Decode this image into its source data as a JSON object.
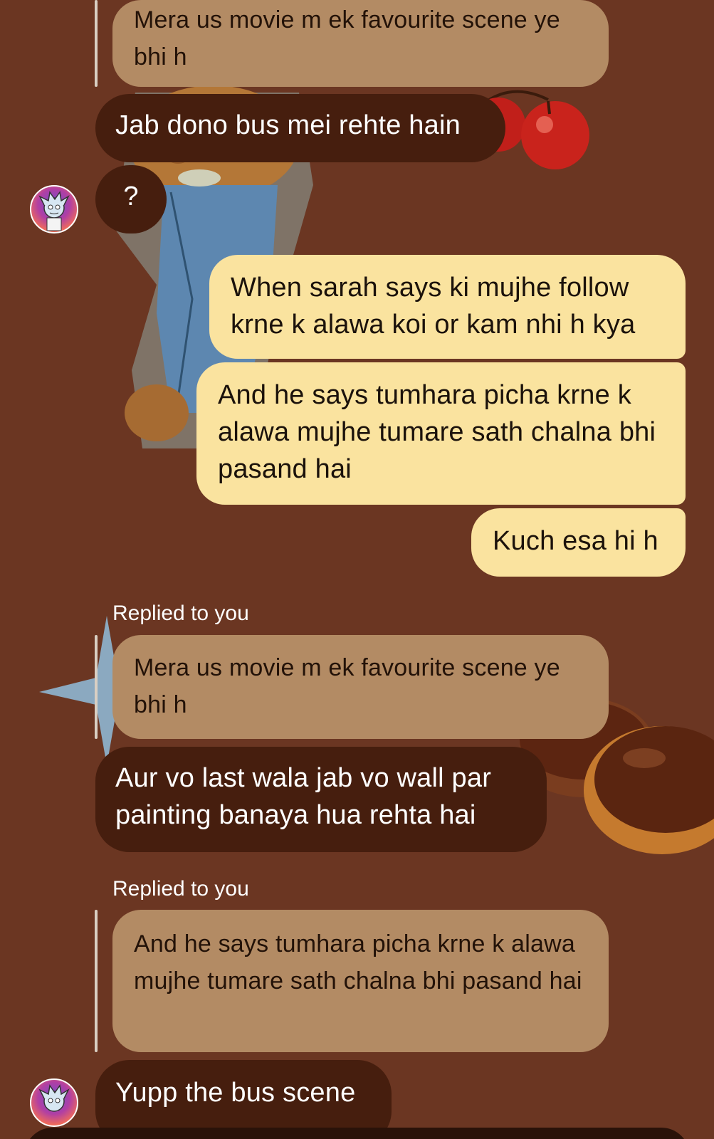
{
  "messages": [
    {
      "kind": "quoted",
      "text": "Mera us movie m ek favourite scene ye bhi h"
    },
    {
      "kind": "incoming",
      "text": "Jab dono bus mei rehte hain"
    },
    {
      "kind": "incoming",
      "text": "?"
    },
    {
      "kind": "outgoing",
      "text": "When sarah says ki mujhe follow krne k alawa koi or kam nhi h kya"
    },
    {
      "kind": "outgoing",
      "text": "And he says tumhara picha krne k alawa mujhe tumare sath chalna bhi pasand hai"
    },
    {
      "kind": "outgoing",
      "text": "Kuch esa hi h"
    },
    {
      "kind": "reply_label",
      "text": "Replied to you"
    },
    {
      "kind": "quoted",
      "text": "Mera us movie m ek favourite scene ye bhi h"
    },
    {
      "kind": "incoming",
      "text": "Aur vo last wala jab vo wall par painting banaya hua rehta hai"
    },
    {
      "kind": "reply_label",
      "text": "Replied to you"
    },
    {
      "kind": "quoted",
      "text": "And he says tumhara picha krne k alawa mujhe tumare sath chalna bhi pasand hai"
    },
    {
      "kind": "incoming",
      "text": "Yupp the bus scene"
    }
  ],
  "theme": {
    "background": "#6b3622",
    "incoming_bubble": "#461e0e",
    "outgoing_bubble": "#fae39f",
    "quoted_bubble": "#b38b64"
  },
  "avatar_icon": "cartoon-character-avatar"
}
